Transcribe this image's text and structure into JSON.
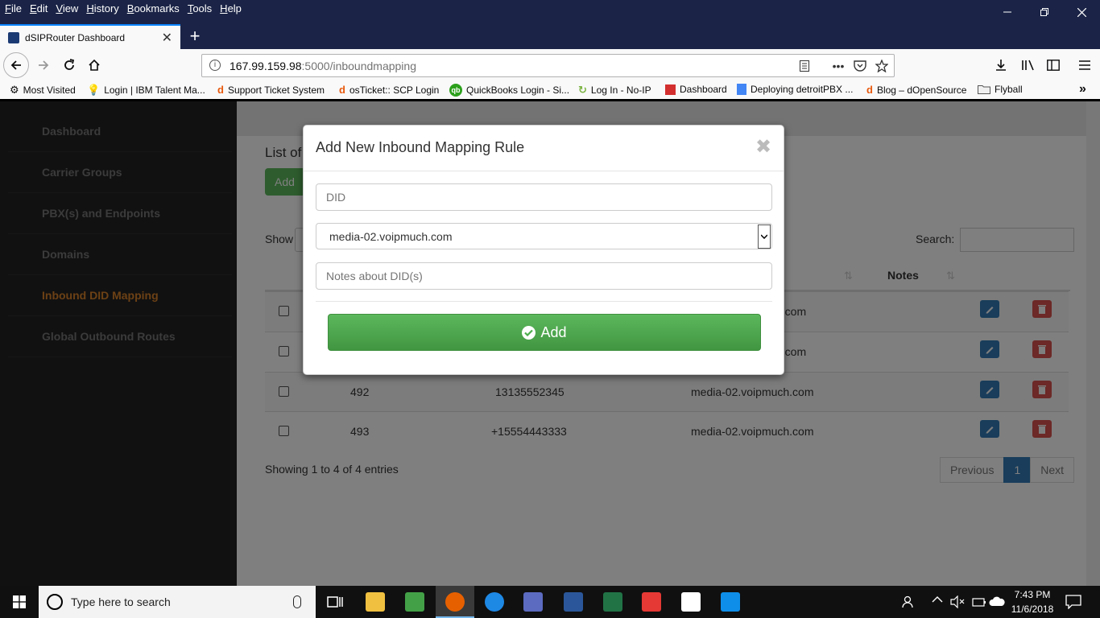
{
  "browser": {
    "menu": [
      "File",
      "Edit",
      "View",
      "History",
      "Bookmarks",
      "Tools",
      "Help"
    ],
    "tab_title": "dSIPRouter Dashboard",
    "url_host": "167.99.159.98",
    "url_path": ":5000/inboundmapping",
    "bookmarks": [
      "Most Visited",
      "Login | IBM Talent Ma...",
      "Support Ticket System",
      "osTicket:: SCP Login",
      "QuickBooks Login - Si...",
      "Log In - No-IP",
      "Dashboard",
      "Deploying detroitPBX ...",
      "Blog – dOpenSource",
      "Flyball"
    ]
  },
  "sidebar": {
    "items": [
      {
        "label": "Dashboard"
      },
      {
        "label": "Carrier Groups"
      },
      {
        "label": "PBX(s) and Endpoints"
      },
      {
        "label": "Domains"
      },
      {
        "label": "Inbound DID Mapping",
        "active": true
      },
      {
        "label": "Global Outbound Routes"
      }
    ]
  },
  "main": {
    "list_title": "List of",
    "add_label": "Add",
    "show_label": "Show",
    "search_label": "Search:",
    "col_notes": "Notes",
    "rows": [
      {
        "id": "",
        "did": "",
        "domain": "h.com"
      },
      {
        "id": "",
        "did": "",
        "domain": "h.com"
      },
      {
        "id": "492",
        "did": "13135552345",
        "domain": "media-02.voipmuch.com"
      },
      {
        "id": "493",
        "did": "+15554443333",
        "domain": "media-02.voipmuch.com"
      }
    ],
    "showing": "Showing 1 to 4 of 4 entries",
    "pager": {
      "prev": "Previous",
      "current": "1",
      "next": "Next"
    }
  },
  "modal": {
    "title": "Add New Inbound Mapping Rule",
    "close": "✖",
    "did_placeholder": "DID",
    "select_value": "media-02.voipmuch.com",
    "notes_placeholder": "Notes about DID(s)",
    "add_label": "Add"
  },
  "taskbar": {
    "search_placeholder": "Type here to search",
    "time": "7:43 PM",
    "date": "11/6/2018"
  },
  "colors": {
    "accent_active_nav": "#d9822b",
    "add_button": "#5cb85c",
    "edit_button": "#337ab7",
    "delete_button": "#d9534f",
    "titlebar": "#1b2447"
  }
}
